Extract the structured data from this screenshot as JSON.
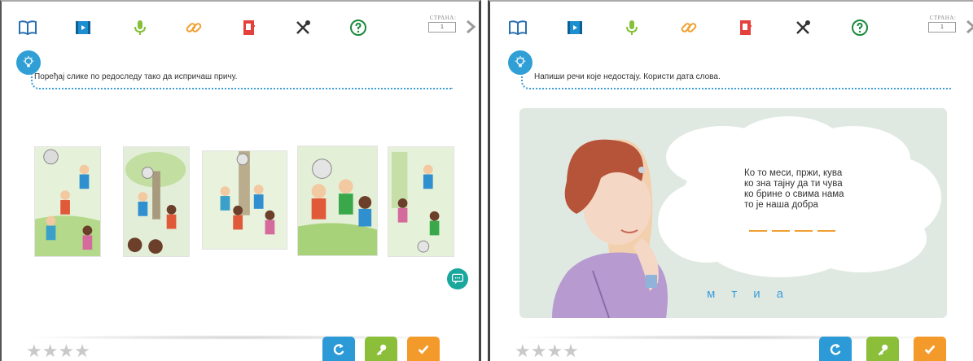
{
  "left": {
    "toolbar": {
      "icons": [
        "book-icon",
        "film-icon",
        "microphone-icon",
        "link-icon",
        "document-icon",
        "tools-icon",
        "help-icon"
      ],
      "page_label": "СТРАНА:",
      "page_value": "1"
    },
    "instruction": "Поређај слике по редоследу тако да испричаш причу.",
    "images": [
      "story-image-1",
      "story-image-2",
      "story-image-3",
      "story-image-4",
      "story-image-5"
    ],
    "rating": {
      "stars_text": "★★★★",
      "count": 4
    },
    "buttons": {
      "retry": "retry",
      "key": "solution",
      "check": "check"
    }
  },
  "right": {
    "toolbar": {
      "icons": [
        "book-icon",
        "film-icon",
        "microphone-icon",
        "link-icon",
        "document-icon",
        "tools-icon",
        "help-icon"
      ],
      "page_label": "СТРАНА:",
      "page_value": "1"
    },
    "instruction": "Напиши речи које недостају. Користи дата слова.",
    "verse": [
      "Ко то меси, пржи, кува",
      "ко зна тајну да ти чува",
      "ко брине о свима нама",
      "то је наша добра"
    ],
    "blanks_count": 4,
    "letters": [
      "м",
      "т",
      "и",
      "а"
    ],
    "rating": {
      "stars_text": "★★★★",
      "count": 4
    }
  },
  "colors": {
    "accent_blue": "#2b9ad6",
    "accent_green": "#8bbf3a",
    "accent_orange": "#f39a2a",
    "teal": "#1aa79c",
    "scene_bg": "#dfe9e1"
  }
}
